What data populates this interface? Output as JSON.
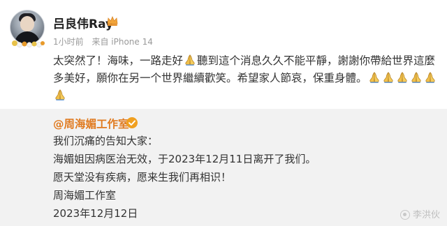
{
  "post": {
    "author": "吕良伟Ray",
    "time": "1小时前",
    "source": "来自 iPhone 14",
    "text_line1_a": "太突然了！海味，一路走好",
    "text_line1_b": "聽到這个消息久久不能平靜，謝謝你帶給世界這麼",
    "text_line2": "多美好，願你在另一个世界繼續歡笑。希望家人節哀，保重身體。"
  },
  "repost": {
    "author": "@周海媚工作室",
    "lines": [
      "我们沉痛的告知大家：",
      "海媚姐因病医治无效，于2023年12月11日离开了我们。",
      "愿天堂没有疾病，愿来生我们再相识！",
      "周海媚工作室",
      "2023年12月12日"
    ]
  },
  "watermark": "李洪伙",
  "colors": {
    "repost_name": "#e07a1f",
    "verified": "#f0a020",
    "repost_bg": "#f2f2f2",
    "pray": "#e9b33a"
  },
  "icons": {
    "pray": "folded-hands-emoji",
    "crown": "crown-icon",
    "verified": "verified-badge"
  }
}
